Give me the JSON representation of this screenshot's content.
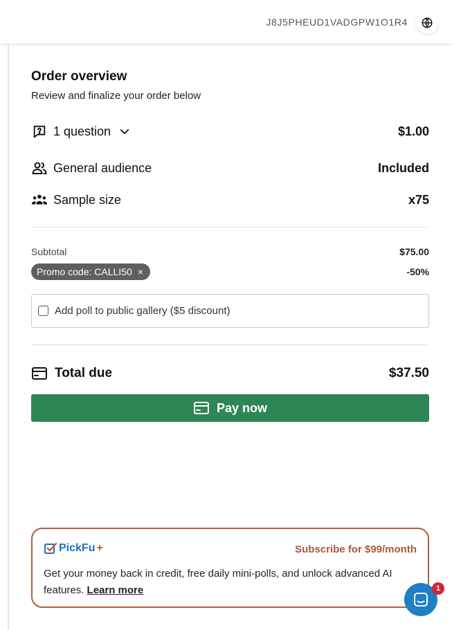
{
  "header": {
    "order_id": "J8J5PHEUD1VADGPW1O1R4",
    "language_icon": "globe-icon"
  },
  "order": {
    "title": "Order overview",
    "subtitle": "Review and finalize your order below",
    "questions_label": "1 question",
    "questions_price": "$1.00",
    "audience_label": "General audience",
    "audience_value": "Included",
    "sample_label": "Sample size",
    "sample_value": "x75"
  },
  "summary": {
    "subtotal_label": "Subtotal",
    "subtotal_value": "$75.00",
    "promo_label": "Promo code: CALLI50",
    "promo_remove": "×",
    "promo_value": "-50%",
    "gallery_label": "Add poll to public gallery ($5 discount)",
    "gallery_checked": false,
    "total_label": "Total due",
    "total_value": "$37.50",
    "pay_label": "Pay now"
  },
  "upsell": {
    "brand_name": "PickFu",
    "brand_plus": "+",
    "subscribe_label": "Subscribe for $99/month",
    "description": "Get your money back in credit, free daily mini-polls, and unlock advanced AI features.",
    "learn_more": "Learn more"
  },
  "chat": {
    "badge_count": "1"
  },
  "colors": {
    "accent_green": "#2e8655",
    "upsell_border": "#b15e3a",
    "brand_blue": "#1e73be",
    "chat_blue": "#1f7ec4",
    "badge_red": "#d4213a"
  }
}
